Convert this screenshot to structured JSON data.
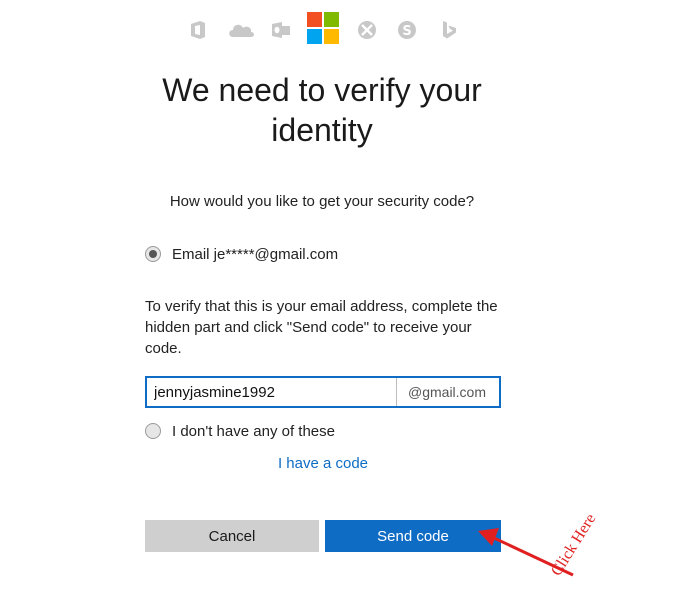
{
  "header": {
    "product_icons": [
      "office-icon",
      "onedrive-icon",
      "outlook-icon",
      "microsoft-logo",
      "xbox-icon",
      "skype-icon",
      "bing-icon"
    ],
    "brand_colors": {
      "red": "#f25022",
      "green": "#7fba00",
      "blue": "#00a4ef",
      "yellow": "#ffb900",
      "icon_gray": "#c8c8c8"
    }
  },
  "page": {
    "title_line1": "We need to verify your",
    "title_line2": "identity",
    "question": "How would you like to get your security code?"
  },
  "options": {
    "email_label": "Email je*****@gmail.com",
    "email_selected": true,
    "none_label": "I don't have any of these",
    "none_selected": false
  },
  "verify": {
    "description": "To verify that this is your email address, complete the hidden part and click \"Send code\" to receive your code.",
    "input_value": "jennyjasmine1992",
    "email_suffix": "@gmail.com"
  },
  "links": {
    "have_code": "I have a code"
  },
  "buttons": {
    "cancel": "Cancel",
    "send": "Send code"
  },
  "annotation": {
    "text": "Click Here",
    "color": "#e02020"
  },
  "colors": {
    "accent": "#0f6cc4",
    "cancel_bg": "#cfcfcf"
  }
}
